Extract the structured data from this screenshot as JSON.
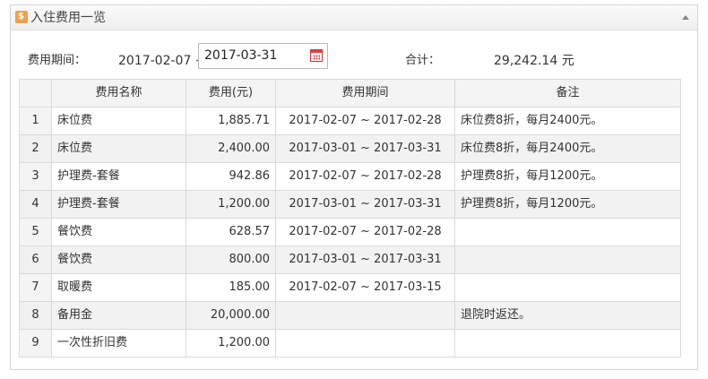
{
  "panel": {
    "title": "入住费用一览",
    "icon": "money-bag-icon"
  },
  "filter": {
    "period_label": "费用期间：",
    "start_date": "2017-02-07 ~",
    "end_date": "2017-03-31",
    "total_label": "合计：",
    "total_value": "29,242.14 元"
  },
  "table": {
    "columns": [
      "",
      "费用名称",
      "费用(元)",
      "费用期间",
      "备注"
    ],
    "rows": [
      {
        "no": "1",
        "name": "床位费",
        "amount": "1,885.71",
        "period": "2017-02-07 ~ 2017-02-28",
        "note": "床位费8折，每月2400元。"
      },
      {
        "no": "2",
        "name": "床位费",
        "amount": "2,400.00",
        "period": "2017-03-01 ~ 2017-03-31",
        "note": "床位费8折，每月2400元。"
      },
      {
        "no": "3",
        "name": "护理费-套餐",
        "amount": "942.86",
        "period": "2017-02-07 ~ 2017-02-28",
        "note": "护理费8折，每月1200元。"
      },
      {
        "no": "4",
        "name": "护理费-套餐",
        "amount": "1,200.00",
        "period": "2017-03-01 ~ 2017-03-31",
        "note": "护理费8折，每月1200元。"
      },
      {
        "no": "5",
        "name": "餐饮费",
        "amount": "628.57",
        "period": "2017-02-07 ~ 2017-02-28",
        "note": ""
      },
      {
        "no": "6",
        "name": "餐饮费",
        "amount": "800.00",
        "period": "2017-03-01 ~ 2017-03-31",
        "note": ""
      },
      {
        "no": "7",
        "name": "取暖费",
        "amount": "185.00",
        "period": "2017-02-07 ~ 2017-03-15",
        "note": ""
      },
      {
        "no": "8",
        "name": "备用金",
        "amount": "20,000.00",
        "period": "",
        "note": "退院时返还。"
      },
      {
        "no": "9",
        "name": "一次性折旧费",
        "amount": "1,200.00",
        "period": "",
        "note": ""
      }
    ]
  },
  "colors": {
    "header_bg": "#eeeeee",
    "row_alt_bg": "#f2f2f2",
    "border": "#dadada",
    "icon_orange": "#f0a04a",
    "calendar_red": "#d44444"
  }
}
